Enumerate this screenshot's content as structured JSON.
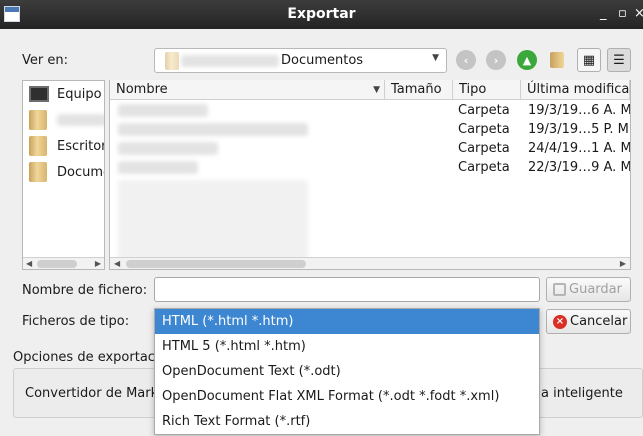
{
  "window": {
    "title": "Exportar",
    "minimize": "_",
    "maximize": "▫",
    "close": "×"
  },
  "lookin": {
    "label": "Ver en:",
    "path_visible": "Documentos"
  },
  "toolbar": {
    "back_icon": "back-arrow-icon",
    "forward_icon": "forward-arrow-icon",
    "up_icon": "up-arrow-icon",
    "new_folder_icon": "new-folder-icon",
    "list_view_icon": "list-view-icon",
    "detail_view_icon": "detail-view-icon"
  },
  "sidebar": {
    "items": [
      {
        "label": "Equipo",
        "icon": "computer-icon"
      },
      {
        "label": "",
        "icon": "folder-icon"
      },
      {
        "label": "Escritorio",
        "icon": "folder-icon"
      },
      {
        "label": "Documentos",
        "icon": "folder-icon"
      }
    ]
  },
  "table": {
    "headers": [
      "Nombre",
      "Tamaño",
      "Tipo",
      "Última modificación"
    ],
    "rows": [
      {
        "type": "Carpeta",
        "date": "19/3/19…6 A. M."
      },
      {
        "type": "Carpeta",
        "date": "19/3/19…5 P. M."
      },
      {
        "type": "Carpeta",
        "date": "24/4/19…1 A. M."
      },
      {
        "type": "Carpeta",
        "date": "22/3/19…9 A. M."
      }
    ]
  },
  "filename": {
    "label": "Nombre de fichero:",
    "value": "",
    "save_label": "Guardar"
  },
  "filetype": {
    "label": "Ficheros de tipo:",
    "cancel_label": "Cancelar",
    "options": [
      "HTML (*.html *.htm)",
      "HTML 5 (*.html *.htm)",
      "OpenDocument Text (*.odt)",
      "OpenDocument Flat XML Format (*.odt *.fodt *.xml)",
      "Rich Text Format (*.rtf)"
    ],
    "selected_index": 0
  },
  "export_options": {
    "label": "Opciones de exportac",
    "converter_label": "Convertidor de Mark",
    "smart_label": "a inteligente"
  },
  "colors": {
    "selection": "#3d86d1",
    "titlebar": "#2e2e2e",
    "cancel_icon": "#d93025",
    "up_arrow": "#3aa83a",
    "nav_disabled": "#c4c4c4"
  }
}
